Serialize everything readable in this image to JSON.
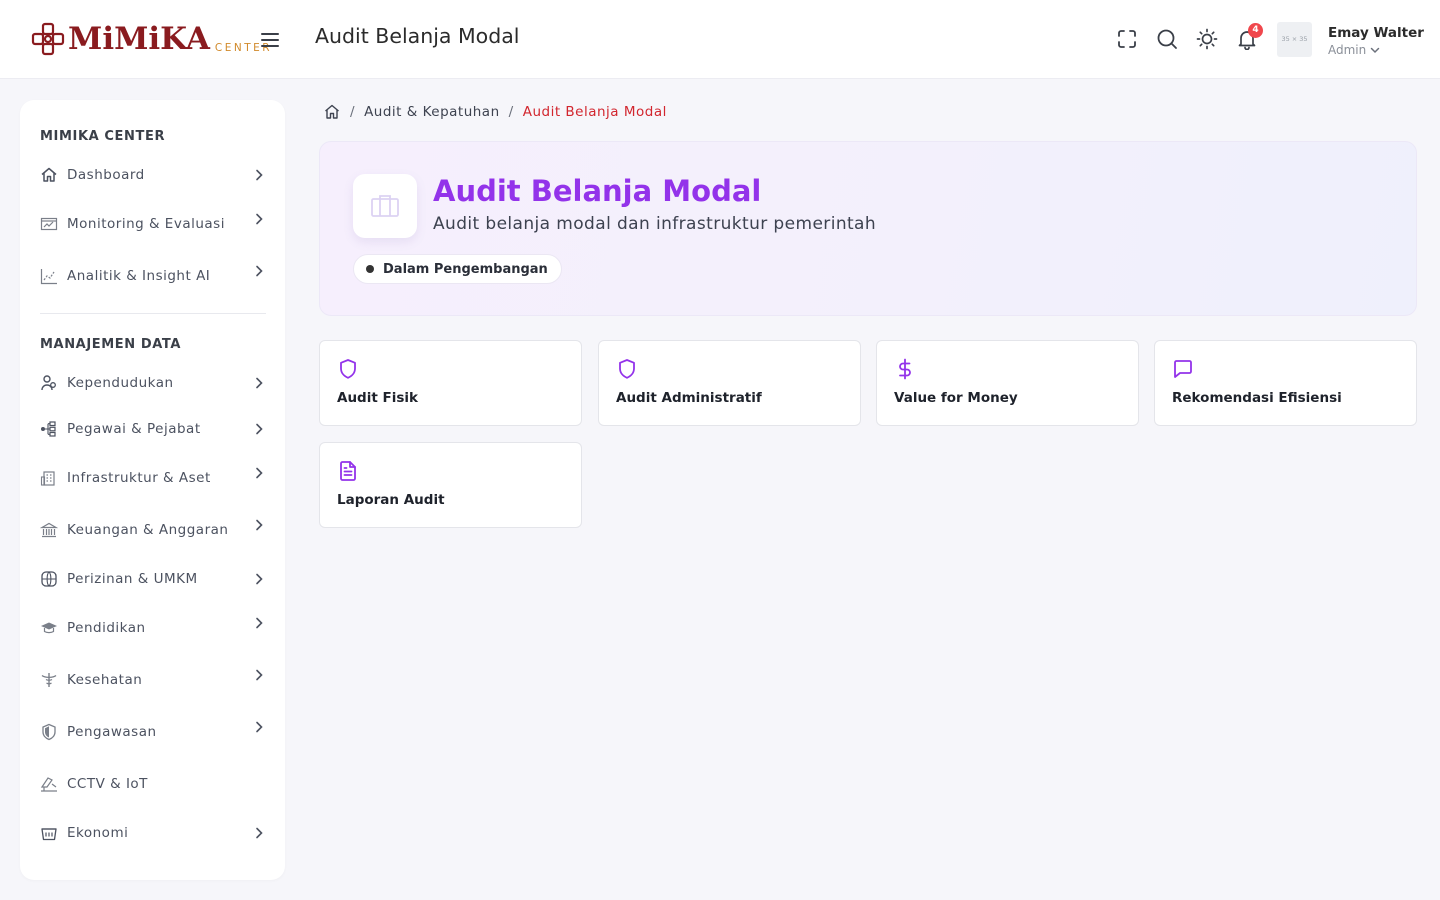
{
  "header": {
    "logo_text": "MiMiKA",
    "logo_sub": "CENTER",
    "page_title": "Audit Belanja Modal",
    "notification_count": "4",
    "avatar_text": "35 × 35",
    "user_name": "Emay Walter",
    "user_role": "Admin",
    "icons": [
      "fullscreen-icon",
      "search-icon",
      "theme-toggle-icon",
      "bell-icon"
    ]
  },
  "sidebar": {
    "section1": "MIMIKA CENTER",
    "section2": "MANAJEMEN DATA",
    "items": [
      {
        "label": "Dashboard",
        "icon": "home-icon"
      },
      {
        "label": "Monitoring & Evaluasi",
        "icon": "monitor-icon"
      },
      {
        "label": "Analitik & Insight AI",
        "icon": "analytics-icon"
      },
      {
        "label": "Kependudukan",
        "icon": "people-icon"
      },
      {
        "label": "Pegawai & Pejabat",
        "icon": "org-icon"
      },
      {
        "label": "Infrastruktur & Aset",
        "icon": "building-icon"
      },
      {
        "label": "Keuangan & Anggaran",
        "icon": "bank-icon"
      },
      {
        "label": "Perizinan & UMKM",
        "icon": "globe-icon"
      },
      {
        "label": "Pendidikan",
        "icon": "graduation-icon"
      },
      {
        "label": "Kesehatan",
        "icon": "caduceus-icon"
      },
      {
        "label": "Pengawasan",
        "icon": "shield-icon"
      },
      {
        "label": "CCTV & IoT",
        "icon": "camera-icon"
      },
      {
        "label": "Ekonomi",
        "icon": "basket-icon"
      }
    ]
  },
  "breadcrumb": {
    "items": [
      "Audit & Kepatuhan"
    ],
    "current": "Audit Belanja Modal"
  },
  "hero": {
    "title": "Audit Belanja Modal",
    "subtitle": "Audit belanja modal dan infrastruktur pemerintah",
    "status": "Dalam Pengembangan"
  },
  "cards": [
    {
      "title": "Audit Fisik",
      "icon": "shield-icon"
    },
    {
      "title": "Audit Administratif",
      "icon": "shield-icon"
    },
    {
      "title": "Value for Money",
      "icon": "dollar-icon"
    },
    {
      "title": "Rekomendasi Efisiensi",
      "icon": "message-icon"
    },
    {
      "title": "Laporan Audit",
      "icon": "document-icon"
    }
  ],
  "colors": {
    "accent": "#9333ea",
    "breadcrumb_active": "#d2262e",
    "logo": "#8a1b1f",
    "badge": "#f0474c"
  }
}
